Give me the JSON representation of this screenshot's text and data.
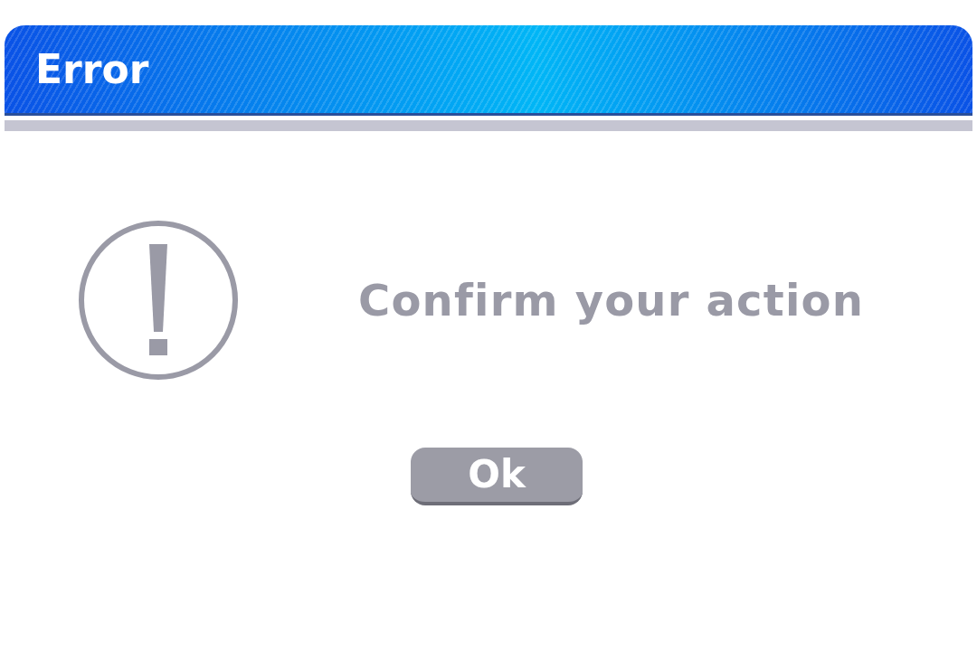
{
  "window": {
    "title": "Error"
  },
  "message": "Confirm your action",
  "buttons": [
    "Ok"
  ]
}
